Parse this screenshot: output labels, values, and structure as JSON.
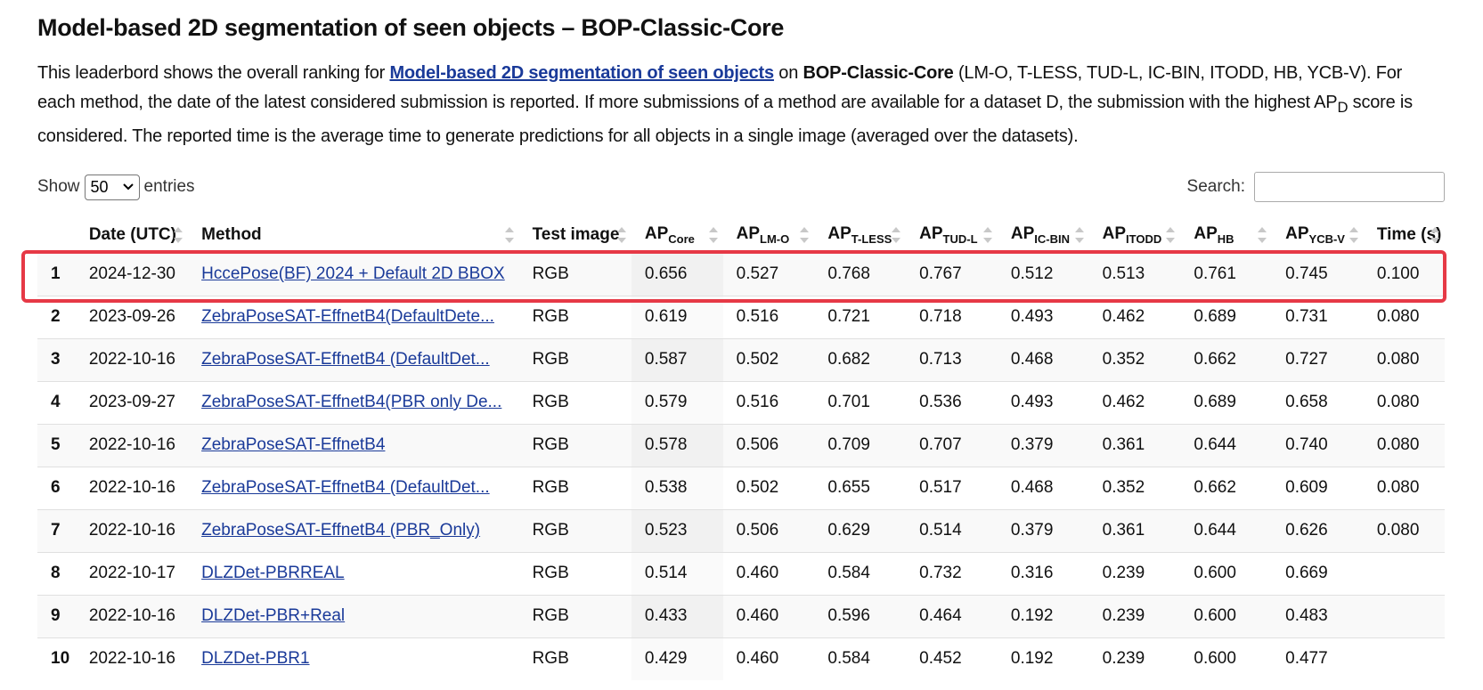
{
  "page": {
    "title": "Model-based 2D segmentation of seen objects – BOP-Classic-Core",
    "intro_1": "This leaderbord shows the overall ranking for ",
    "intro_link": "Model-based 2D segmentation of seen objects",
    "intro_2": " on ",
    "intro_dataset": "BOP-Classic-Core",
    "intro_3": " (LM-O, T-LESS, TUD-L, IC-BIN, ITODD, HB, YCB-V). For each method, the date of the latest considered submission is reported. If more submissions of a method are available for a dataset D, the submission with the highest AP",
    "intro_sub": "D",
    "intro_4": " score is considered. The reported time is the average time to generate predictions for all objects in a single image (averaged over the datasets)."
  },
  "controls": {
    "show_label": "Show",
    "entries_value": "50",
    "entries_label": "entries",
    "search_label": "Search:",
    "search_value": ""
  },
  "table": {
    "headers": [
      {
        "main": "",
        "sub": ""
      },
      {
        "main": "Date (UTC)",
        "sub": ""
      },
      {
        "main": "Method",
        "sub": ""
      },
      {
        "main": "Test image",
        "sub": ""
      },
      {
        "main": "AP",
        "sub": "Core"
      },
      {
        "main": "AP",
        "sub": "LM-O"
      },
      {
        "main": "AP",
        "sub": "T-LESS"
      },
      {
        "main": "AP",
        "sub": "TUD-L"
      },
      {
        "main": "AP",
        "sub": "IC-BIN"
      },
      {
        "main": "AP",
        "sub": "ITODD"
      },
      {
        "main": "AP",
        "sub": "HB"
      },
      {
        "main": "AP",
        "sub": "YCB-V"
      },
      {
        "main": "Time (s)",
        "sub": ""
      }
    ],
    "rows": [
      [
        "1",
        "2024-12-30",
        "HccePose(BF) 2024 + Default 2D BBOX",
        "RGB",
        "0.656",
        "0.527",
        "0.768",
        "0.767",
        "0.512",
        "0.513",
        "0.761",
        "0.745",
        "0.100"
      ],
      [
        "2",
        "2023-09-26",
        "ZebraPoseSAT-EffnetB4(DefaultDete...",
        "RGB",
        "0.619",
        "0.516",
        "0.721",
        "0.718",
        "0.493",
        "0.462",
        "0.689",
        "0.731",
        "0.080"
      ],
      [
        "3",
        "2022-10-16",
        "ZebraPoseSAT-EffnetB4 (DefaultDet...",
        "RGB",
        "0.587",
        "0.502",
        "0.682",
        "0.713",
        "0.468",
        "0.352",
        "0.662",
        "0.727",
        "0.080"
      ],
      [
        "4",
        "2023-09-27",
        "ZebraPoseSAT-EffnetB4(PBR only De...",
        "RGB",
        "0.579",
        "0.516",
        "0.701",
        "0.536",
        "0.493",
        "0.462",
        "0.689",
        "0.658",
        "0.080"
      ],
      [
        "5",
        "2022-10-16",
        "ZebraPoseSAT-EffnetB4",
        "RGB",
        "0.578",
        "0.506",
        "0.709",
        "0.707",
        "0.379",
        "0.361",
        "0.644",
        "0.740",
        "0.080"
      ],
      [
        "6",
        "2022-10-16",
        "ZebraPoseSAT-EffnetB4 (DefaultDet...",
        "RGB",
        "0.538",
        "0.502",
        "0.655",
        "0.517",
        "0.468",
        "0.352",
        "0.662",
        "0.609",
        "0.080"
      ],
      [
        "7",
        "2022-10-16",
        "ZebraPoseSAT-EffnetB4 (PBR_Only)",
        "RGB",
        "0.523",
        "0.506",
        "0.629",
        "0.514",
        "0.379",
        "0.361",
        "0.644",
        "0.626",
        "0.080"
      ],
      [
        "8",
        "2022-10-17",
        "DLZDet-PBRREAL",
        "RGB",
        "0.514",
        "0.460",
        "0.584",
        "0.732",
        "0.316",
        "0.239",
        "0.600",
        "0.669",
        ""
      ],
      [
        "9",
        "2022-10-16",
        "DLZDet-PBR+Real",
        "RGB",
        "0.433",
        "0.460",
        "0.596",
        "0.464",
        "0.192",
        "0.239",
        "0.600",
        "0.483",
        ""
      ],
      [
        "10",
        "2022-10-16",
        "DLZDet-PBR1",
        "RGB",
        "0.429",
        "0.460",
        "0.584",
        "0.452",
        "0.192",
        "0.239",
        "0.600",
        "0.477",
        ""
      ]
    ],
    "highlighted_row": 1,
    "highlight_color": "#e63946",
    "link_color": "#1a3a99"
  }
}
